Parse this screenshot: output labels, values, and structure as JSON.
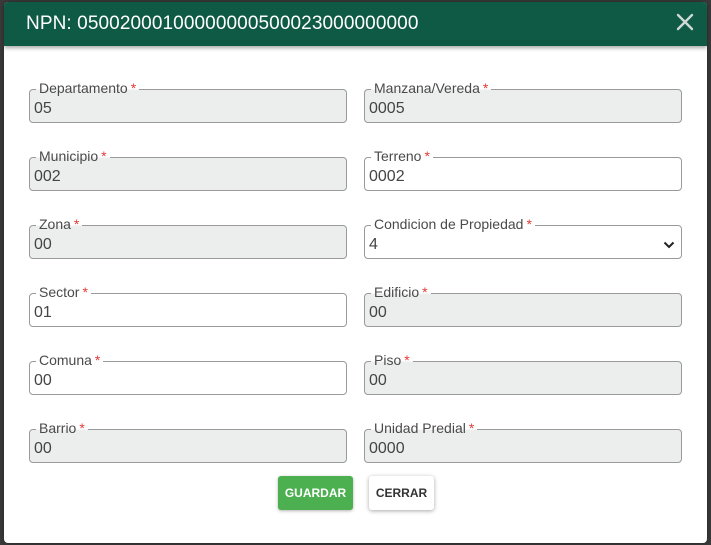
{
  "modal": {
    "title": "NPN: 05002000100000000500023000000000",
    "header_color": "#0e5a45"
  },
  "fields": {
    "departamento": {
      "label": "Departamento",
      "value": "05",
      "required": "*"
    },
    "manzana": {
      "label": "Manzana/Vereda",
      "value": "0005",
      "required": "*"
    },
    "municipio": {
      "label": "Municipio",
      "value": "002",
      "required": "*"
    },
    "terreno": {
      "label": "Terreno",
      "value": "0002",
      "required": "*"
    },
    "zona": {
      "label": "Zona",
      "value": "00",
      "required": "*"
    },
    "condicion": {
      "label": "Condicion de Propiedad",
      "value": "4",
      "required": "*"
    },
    "sector": {
      "label": "Sector",
      "value": "01",
      "required": "*"
    },
    "edificio": {
      "label": "Edificio",
      "value": "00",
      "required": "*"
    },
    "comuna": {
      "label": "Comuna",
      "value": "00",
      "required": "*"
    },
    "piso": {
      "label": "Piso",
      "value": "00",
      "required": "*"
    },
    "barrio": {
      "label": "Barrio",
      "value": "00",
      "required": "*"
    },
    "unidad": {
      "label": "Unidad Predial",
      "value": "0000",
      "required": "*"
    }
  },
  "buttons": {
    "save_label": "GUARDAR",
    "close_label": "CERRAR",
    "save_color": "#4caf50"
  }
}
